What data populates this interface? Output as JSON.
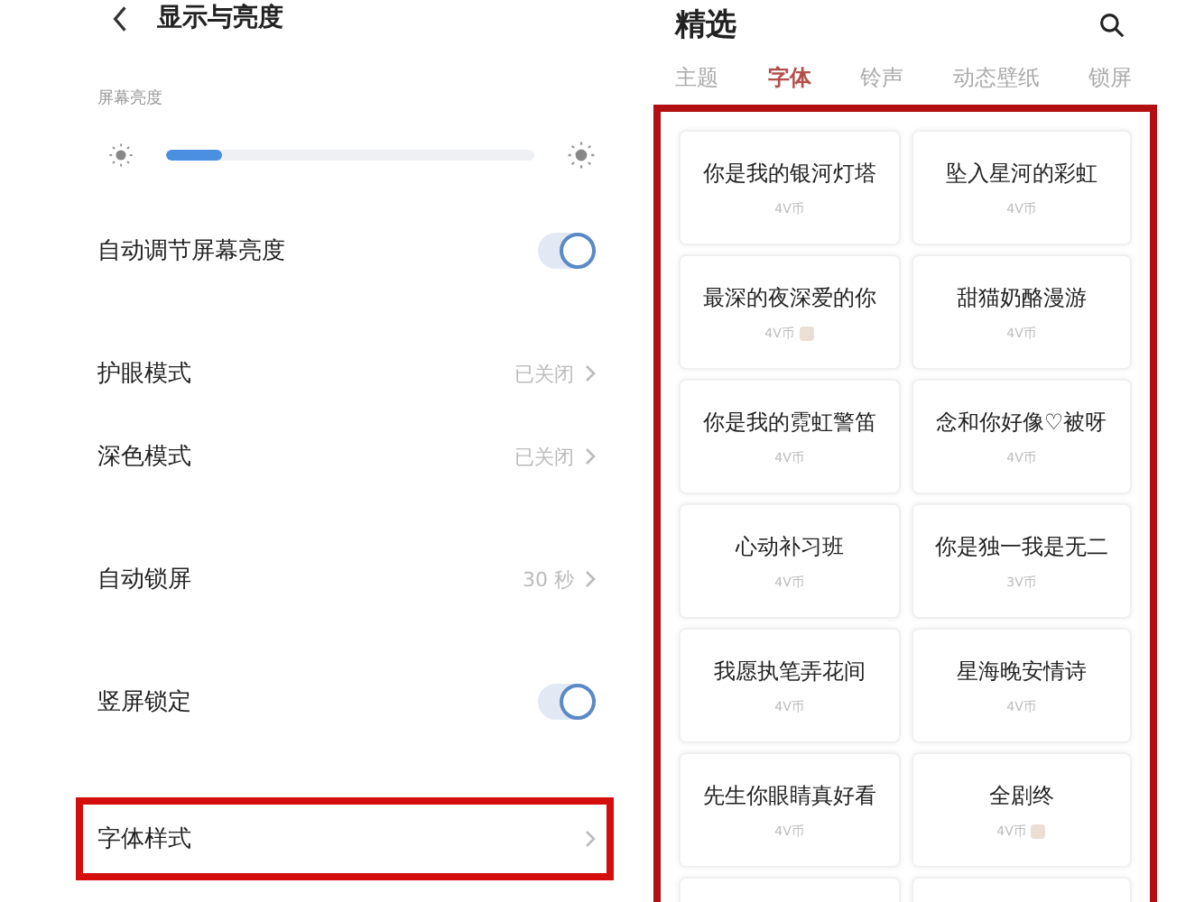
{
  "settings": {
    "title": "显示与亮度",
    "brightness_label": "屏幕亮度",
    "brightness": {
      "level": 0.15
    },
    "groups": [
      [
        {
          "kind": "toggle",
          "label": "自动调节屏幕亮度",
          "on": true,
          "highlighted": false
        }
      ],
      [
        {
          "kind": "link",
          "label": "护眼模式",
          "value": "已关闭",
          "highlighted": false
        },
        {
          "kind": "link",
          "label": "深色模式",
          "value": "已关闭",
          "highlighted": false
        }
      ],
      [
        {
          "kind": "link",
          "label": "自动锁屏",
          "value": "30 秒",
          "highlighted": false
        }
      ],
      [
        {
          "kind": "toggle",
          "label": "竖屏锁定",
          "on": true,
          "highlighted": false
        }
      ],
      [
        {
          "kind": "link",
          "label": "字体样式",
          "highlighted": true
        }
      ]
    ]
  },
  "store": {
    "title": "精选",
    "tabs": [
      {
        "label": "主题",
        "selected": false
      },
      {
        "label": "字体",
        "selected": true
      },
      {
        "label": "铃声",
        "selected": false
      },
      {
        "label": "动态壁纸",
        "selected": false
      },
      {
        "label": "锁屏",
        "selected": false
      }
    ],
    "grid_highlighted": true,
    "fonts": [
      {
        "name": "你是我的银河灯塔",
        "price": "4V币",
        "badge": false
      },
      {
        "name": "坠入星河的彩虹",
        "price": "4V币",
        "badge": false
      },
      {
        "name": "最深的夜深爱的你",
        "price": "4V币",
        "badge": true
      },
      {
        "name": "甜猫奶酪漫游",
        "price": "4V币",
        "badge": false
      },
      {
        "name": "你是我的霓虹警笛",
        "price": "4V币",
        "badge": false
      },
      {
        "name": "念和你好像♡被呀",
        "price": "4V币",
        "badge": false
      },
      {
        "name": "心动补习班",
        "price": "4V币",
        "badge": false
      },
      {
        "name": "你是独一我是无二",
        "price": "3V币",
        "badge": false
      },
      {
        "name": "我愿执笔弄花间",
        "price": "4V币",
        "badge": false
      },
      {
        "name": "星海晚安情诗",
        "price": "4V币",
        "badge": false
      },
      {
        "name": "先生你眼睛真好看",
        "price": "4V币",
        "badge": false
      },
      {
        "name": "全剧终",
        "price": "4V币",
        "badge": true
      }
    ]
  }
}
